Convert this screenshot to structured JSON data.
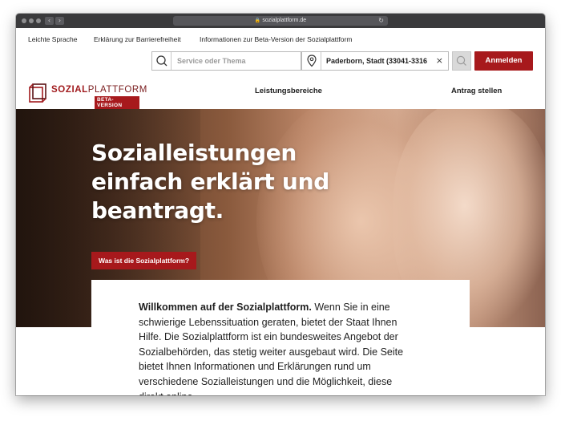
{
  "browser": {
    "url": "sozialplattform.de",
    "back_glyph": "‹",
    "forward_glyph": "›",
    "lock_glyph": "🔒",
    "reload_glyph": "↻"
  },
  "utility_links": [
    "Leichte Sprache",
    "Erklärung zur Barrierefreiheit",
    "Informationen zur Beta-Version der Sozialplattform"
  ],
  "search": {
    "placeholder": "Service oder Thema",
    "location_value": "Paderborn, Stadt (33041-3316",
    "clear_glyph": "×"
  },
  "login_label": "Anmelden",
  "logo": {
    "part1": "SOZIAL",
    "part2": "PLATTFORM",
    "badge": "BETA-VERSION"
  },
  "nav": {
    "services": "Leistungsbereiche",
    "apply": "Antrag stellen"
  },
  "hero": {
    "title": "Sozialleistungen einfach erklärt und beantragt.",
    "button": "Was ist die Sozialplattform?"
  },
  "welcome": {
    "lead": "Willkommen auf der Sozialplattform.",
    "body": " Wenn Sie in eine schwierige Lebenssituation geraten, bietet der Staat Ihnen Hilfe. Die Sozialplattform ist ein bundesweites Angebot der Sozialbehörden, das stetig weiter ausgebaut wird. Die Seite bietet Ihnen Informationen und Erklärungen rund um verschiedene Sozialleistungen und die Möglichkeit, diese direkt online"
  },
  "colors": {
    "brand_red": "#a7191c",
    "chrome_dark": "#3a3a3c"
  },
  "icons": {
    "search": "magnifier-icon",
    "location": "map-pin-icon",
    "logo_mark": "stacked-frames-icon"
  }
}
